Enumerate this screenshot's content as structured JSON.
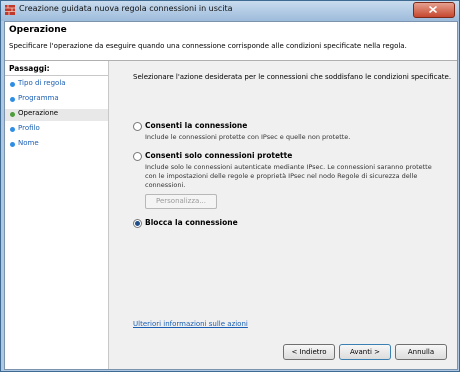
{
  "window": {
    "title": "Creazione guidata nuova regola connessioni in uscita"
  },
  "header": {
    "title": "Operazione",
    "description": "Specificare l'operazione da eseguire quando una connessione corrisponde alle condizioni specificate nella regola."
  },
  "sidebar": {
    "heading": "Passaggi:",
    "steps": [
      {
        "label": "Tipo di regola"
      },
      {
        "label": "Programma"
      },
      {
        "label": "Operazione"
      },
      {
        "label": "Profilo"
      },
      {
        "label": "Nome"
      }
    ]
  },
  "main": {
    "intro": "Selezionare l'azione desiderata per le connessioni che soddisfano le condizioni specificate.",
    "options": [
      {
        "label": "Consenti la connessione",
        "description": "Include le connessioni protette con IPsec e quelle non protette.",
        "selected": false
      },
      {
        "label": "Consenti solo connessioni protette",
        "description": "Include solo le connessioni autenticate mediante IPsec. Le connessioni saranno protette con le impostazioni delle regole e proprietà IPsec nel nodo Regole di sicurezza delle connessioni.",
        "selected": false
      },
      {
        "label": "Blocca la connessione",
        "description": "",
        "selected": true
      }
    ],
    "customize_label": "Personalizza...",
    "more_info_link": "Ulteriori informazioni sulle azioni"
  },
  "buttons": {
    "back": "< Indietro",
    "next": "Avanti >",
    "cancel": "Annulla"
  }
}
